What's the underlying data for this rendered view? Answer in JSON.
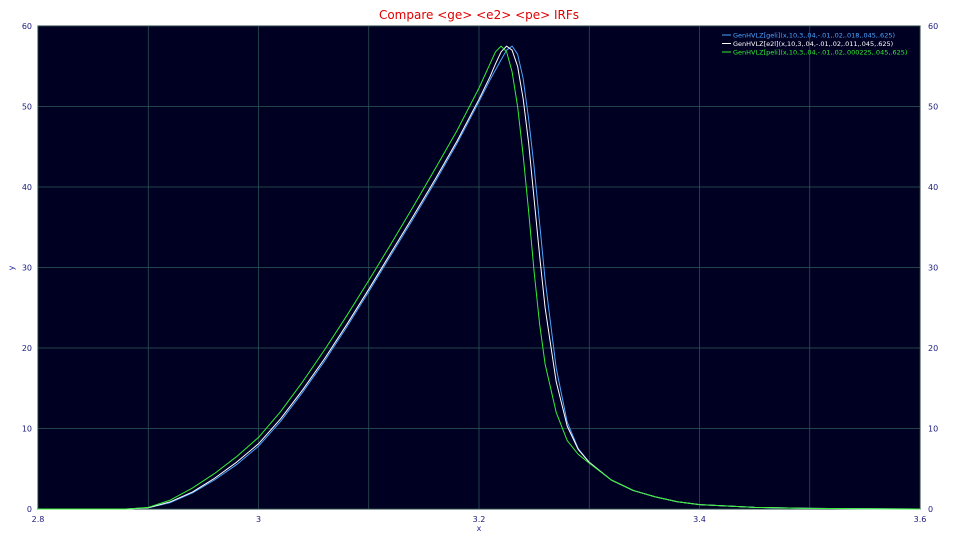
{
  "chart_data": {
    "type": "line",
    "title": "Compare <ge> <e2> <pe> IRFs",
    "xlabel": "x",
    "ylabel": "y",
    "xlim": [
      2.8,
      3.6
    ],
    "ylim": [
      0,
      60
    ],
    "x_ticks": [
      "2.8",
      "3",
      "3.2",
      "3.4",
      "3.6"
    ],
    "y_ticks": [
      "0",
      "10",
      "20",
      "30",
      "40",
      "50",
      "60"
    ],
    "grid": true,
    "legend_position": "top-right",
    "colors": {
      "plot_background": "#000022",
      "grid": "#2f5a5a",
      "frame": "#000000"
    },
    "series": [
      {
        "name": "GenHVLZ[geli](x,10,3,.04,-.01,.02,.018,.045,.625)",
        "color": "#4da6ff",
        "x": [
          2.8,
          2.88,
          2.9,
          2.92,
          2.94,
          2.96,
          2.98,
          3.0,
          3.02,
          3.04,
          3.06,
          3.08,
          3.1,
          3.12,
          3.14,
          3.16,
          3.18,
          3.2,
          3.21,
          3.22,
          3.225,
          3.23,
          3.235,
          3.24,
          3.245,
          3.25,
          3.255,
          3.26,
          3.27,
          3.28,
          3.29,
          3.3,
          3.32,
          3.34,
          3.36,
          3.38,
          3.4,
          3.45,
          3.5,
          3.6
        ],
        "y": [
          0,
          0,
          0.15,
          0.8,
          2.0,
          3.6,
          5.5,
          7.8,
          10.9,
          14.5,
          18.4,
          22.6,
          27.0,
          31.5,
          36.0,
          40.6,
          45.4,
          50.6,
          53.3,
          55.8,
          57.0,
          57.5,
          56.5,
          53.5,
          48.5,
          42.5,
          35.5,
          28.5,
          17.5,
          10.8,
          7.5,
          5.8,
          3.6,
          2.3,
          1.5,
          0.9,
          0.55,
          0.2,
          0.08,
          0
        ]
      },
      {
        "name": "GenHVLZ[e2l](x,10,3,.04,-.01,.02,.011,.045,.625)",
        "color": "#ffffff",
        "x": [
          2.8,
          2.88,
          2.9,
          2.92,
          2.94,
          2.96,
          2.98,
          3.0,
          3.02,
          3.04,
          3.06,
          3.08,
          3.1,
          3.12,
          3.14,
          3.16,
          3.18,
          3.2,
          3.21,
          3.215,
          3.22,
          3.225,
          3.23,
          3.235,
          3.24,
          3.245,
          3.25,
          3.255,
          3.26,
          3.27,
          3.28,
          3.29,
          3.3,
          3.32,
          3.34,
          3.36,
          3.38,
          3.4,
          3.45,
          3.5,
          3.6
        ],
        "y": [
          0,
          0,
          0.15,
          0.9,
          2.1,
          3.8,
          5.8,
          8.1,
          11.2,
          14.8,
          18.7,
          22.9,
          27.3,
          31.8,
          36.3,
          40.9,
          45.7,
          50.9,
          53.7,
          55.3,
          56.8,
          57.5,
          57.0,
          55.0,
          51.0,
          45.5,
          38.5,
          31.5,
          25.0,
          15.8,
          10.3,
          7.4,
          5.8,
          3.6,
          2.3,
          1.5,
          0.9,
          0.55,
          0.2,
          0.08,
          0
        ]
      },
      {
        "name": "GenHVLZ[peli](x,10,3,.04,-.01,.02,.000225,.045,.625)",
        "color": "#33ee33",
        "x": [
          2.8,
          2.88,
          2.9,
          2.92,
          2.94,
          2.96,
          2.98,
          3.0,
          3.02,
          3.04,
          3.06,
          3.08,
          3.1,
          3.12,
          3.14,
          3.16,
          3.18,
          3.2,
          3.21,
          3.215,
          3.22,
          3.225,
          3.23,
          3.235,
          3.24,
          3.245,
          3.25,
          3.255,
          3.26,
          3.27,
          3.28,
          3.29,
          3.3,
          3.32,
          3.34,
          3.36,
          3.38,
          3.4,
          3.45,
          3.5,
          3.6
        ],
        "y": [
          0,
          0,
          0.2,
          1.1,
          2.6,
          4.4,
          6.5,
          8.9,
          12.1,
          15.8,
          19.8,
          24.0,
          28.4,
          32.9,
          37.5,
          42.2,
          47.0,
          52.3,
          55.3,
          56.8,
          57.5,
          56.8,
          54.3,
          50.0,
          44.0,
          37.0,
          29.5,
          23.0,
          18.0,
          12.0,
          8.5,
          6.8,
          5.7,
          3.6,
          2.3,
          1.5,
          0.9,
          0.55,
          0.2,
          0.08,
          0
        ]
      }
    ]
  }
}
